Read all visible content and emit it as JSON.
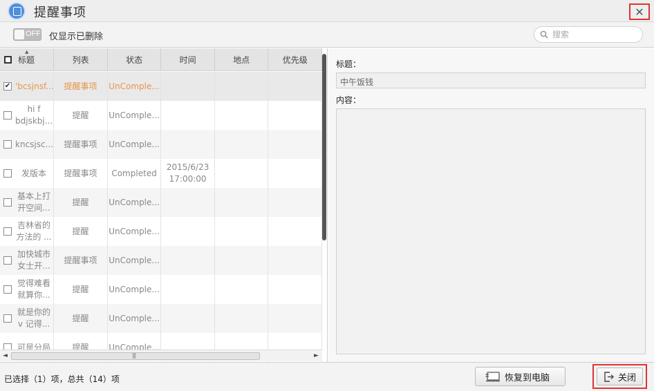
{
  "window": {
    "title": "提醒事项",
    "close_glyph": "✕"
  },
  "toolbar": {
    "toggle_state": "OFF",
    "filter_label": "仅显示已删除",
    "search_placeholder": "搜索"
  },
  "table": {
    "columns": [
      "标题",
      "列表",
      "状态",
      "时间",
      "地点",
      "优先级"
    ],
    "rows": [
      {
        "checked": true,
        "title": "'bcsjnsf...",
        "list": "提醒事项",
        "status": "UnComple...",
        "time": "",
        "place": "",
        "priority": ""
      },
      {
        "checked": false,
        "title": "hi f bdjskbj...",
        "list": "提醒",
        "status": "UnComple...",
        "time": "",
        "place": "",
        "priority": ""
      },
      {
        "checked": false,
        "title": "kncsjsc...",
        "list": "提醒事项",
        "status": "UnComple...",
        "time": "",
        "place": "",
        "priority": ""
      },
      {
        "checked": false,
        "title": "发版本",
        "list": "提醒事项",
        "status": "Completed",
        "time": "2015/6/23 17:00:00",
        "place": "",
        "priority": ""
      },
      {
        "checked": false,
        "title": "基本上打开空间...",
        "list": "提醒",
        "status": "UnComple...",
        "time": "",
        "place": "",
        "priority": ""
      },
      {
        "checked": false,
        "title": "吉林省的方法的 ...",
        "list": "提醒",
        "status": "UnComple...",
        "time": "",
        "place": "",
        "priority": ""
      },
      {
        "checked": false,
        "title": "加快城市女士开...",
        "list": "提醒事项",
        "status": "UnComple...",
        "time": "",
        "place": "",
        "priority": ""
      },
      {
        "checked": false,
        "title": "觉得难看就算你...",
        "list": "提醒",
        "status": "UnComple...",
        "time": "",
        "place": "",
        "priority": ""
      },
      {
        "checked": false,
        "title": "就是你的v 记得...",
        "list": "提醒",
        "status": "UnComple...",
        "time": "",
        "place": "",
        "priority": ""
      },
      {
        "checked": false,
        "title": "可是分局",
        "list": "提醒",
        "status": "UnComple...",
        "time": "",
        "place": "",
        "priority": ""
      }
    ],
    "hscroll_left": "◄",
    "hscroll_right": "►",
    "hscroll_grip": "|||"
  },
  "detail": {
    "title_label": "标题：",
    "title_value": "中午饭钱",
    "content_label": "内容：",
    "content_value": ""
  },
  "footer": {
    "status_text": "已选择（1）项，总共（14）项",
    "restore_label": "恢复到电脑",
    "close_label": "关闭"
  }
}
